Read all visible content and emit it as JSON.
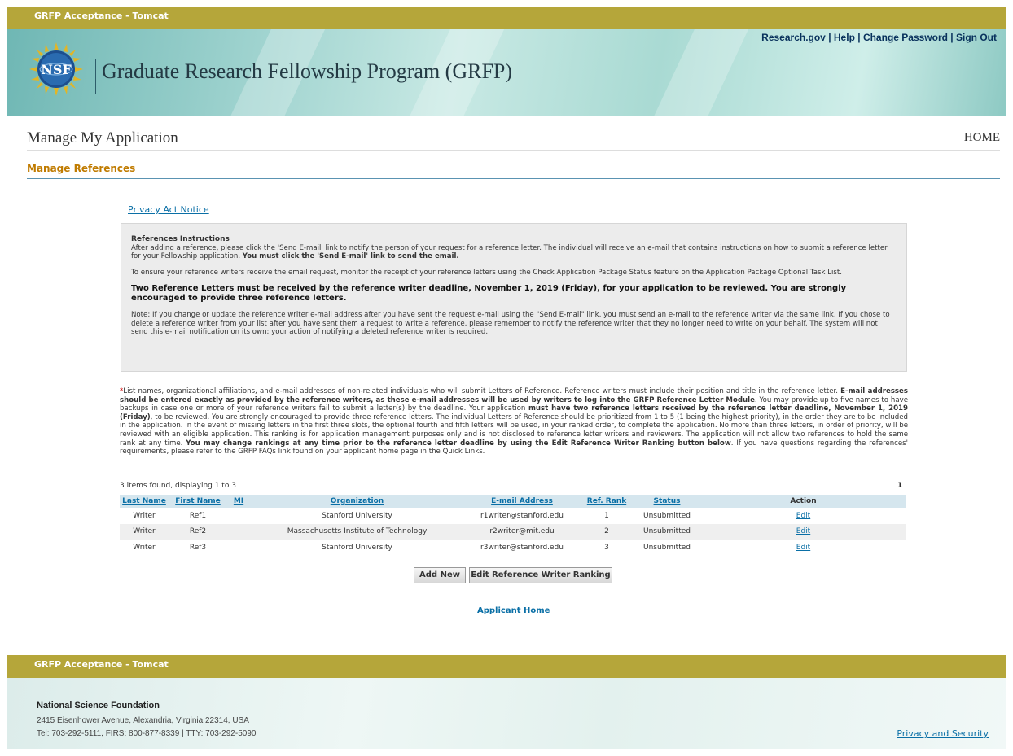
{
  "env": {
    "label": "GRFP Acceptance - Tomcat"
  },
  "header": {
    "links": [
      "Research.gov",
      "Help",
      "Change Password",
      "Sign Out"
    ],
    "logo_text": "NSF",
    "title": "Graduate Research Fellowship Program (GRFP)"
  },
  "page": {
    "heading": "Manage My Application",
    "home": "HOME",
    "subheading": "Manage References",
    "privacy_link": "Privacy Act Notice"
  },
  "instructions": {
    "title": "References Instructions",
    "p1": "After adding a reference, please click the 'Send E-mail' link to notify the person of your request for a reference letter. The individual will receive an e-mail that contains instructions on how to submit a reference letter for your Fellowship application. ",
    "p1_bold": "You must click the 'Send E-mail' link to send the email.",
    "p2": "To ensure your reference writers receive the email request, monitor the receipt of your reference letters using the Check Application Package Status feature on the Application Package Optional Task List.",
    "p3": "Two Reference Letters must be received by the reference writer deadline, November 1, 2019 (Friday), for your application to be reviewed. You are strongly encouraged to provide three reference letters.",
    "p4": "Note: If you change or update the reference writer e-mail address after you have sent the request e-mail using the \"Send E-mail\" link, you must send an e-mail to the reference writer via the same link. If you chose to delete a reference writer from your list after you have sent them a request to write a reference, please remember to notify the reference writer that they no longer need to write on your behalf. The system will not send this e-mail notification on its own; your action of notifying a deleted reference writer is required."
  },
  "description": {
    "asterisk": "*",
    "t1": "List names, organizational affiliations, and e-mail addresses of non-related individuals who will submit Letters of Reference. Reference writers must include their position and title in the reference letter. ",
    "b1": "E-mail addresses should be entered exactly as provided by the reference writers, as these e-mail addresses will be used by writers to log into the GRFP Reference Letter Module",
    "t2": ". You may provide up to five names to have backups in case one or more of your reference writers fail to submit a letter(s) by the deadline. Your application ",
    "b2": "must have two reference letters received by the reference letter deadline, November 1, 2019 (Friday)",
    "t3": ", to be reviewed. You are strongly encouraged to provide three reference letters. The individual Letters of Reference should be prioritized from 1 to 5 (1 being the highest priority), in the order they are to be included in the application. In the event of missing letters in the first three slots, the optional fourth and fifth letters will be used, in your ranked order, to complete the application. No more than three letters, in order of priority, will be reviewed with an eligible application. This ranking is for application management purposes only and is not disclosed to reference letter writers and reviewers. The application will not allow two references to hold the same rank at any time. ",
    "b3": "You may change rankings at any time prior to the reference letter deadline by using the Edit Reference Writer Ranking button below",
    "t4": ". If you have questions regarding the references' requirements, please refer to the GRFP FAQs link found on your applicant home page in the Quick Links."
  },
  "table": {
    "count_text": "3 items found, displaying 1 to 3",
    "page": "1",
    "headers": [
      "Last Name",
      "First Name",
      "MI",
      "Organization",
      "E-mail Address",
      "Ref. Rank",
      "Status",
      "Action"
    ],
    "rows": [
      {
        "last": "Writer",
        "first": "Ref1",
        "mi": "",
        "org": "Stanford University",
        "email": "r1writer@stanford.edu",
        "rank": "1",
        "status": "Unsubmitted",
        "action": "Edit"
      },
      {
        "last": "Writer",
        "first": "Ref2",
        "mi": "",
        "org": "Massachusetts Institute of Technology",
        "email": "r2writer@mit.edu",
        "rank": "2",
        "status": "Unsubmitted",
        "action": "Edit"
      },
      {
        "last": "Writer",
        "first": "Ref3",
        "mi": "",
        "org": "Stanford University",
        "email": "r3writer@stanford.edu",
        "rank": "3",
        "status": "Unsubmitted",
        "action": "Edit"
      }
    ]
  },
  "buttons": {
    "add_new": "Add New",
    "edit_ranking": "Edit Reference Writer Ranking"
  },
  "applicant_home": "Applicant Home",
  "footer": {
    "org": "National Science Foundation",
    "address": "2415 Eisenhower Avenue, Alexandria, Virginia 22314, USA",
    "phones": "Tel: 703-292-5111, FIRS: 800-877-8339 | TTY: 703-292-5090",
    "privacy": "Privacy and Security"
  },
  "colors": {
    "env_bar": "#b5a63a",
    "link": "#0a6fa6",
    "subheading": "#c07b00",
    "table_header": "#d5e6ee"
  }
}
